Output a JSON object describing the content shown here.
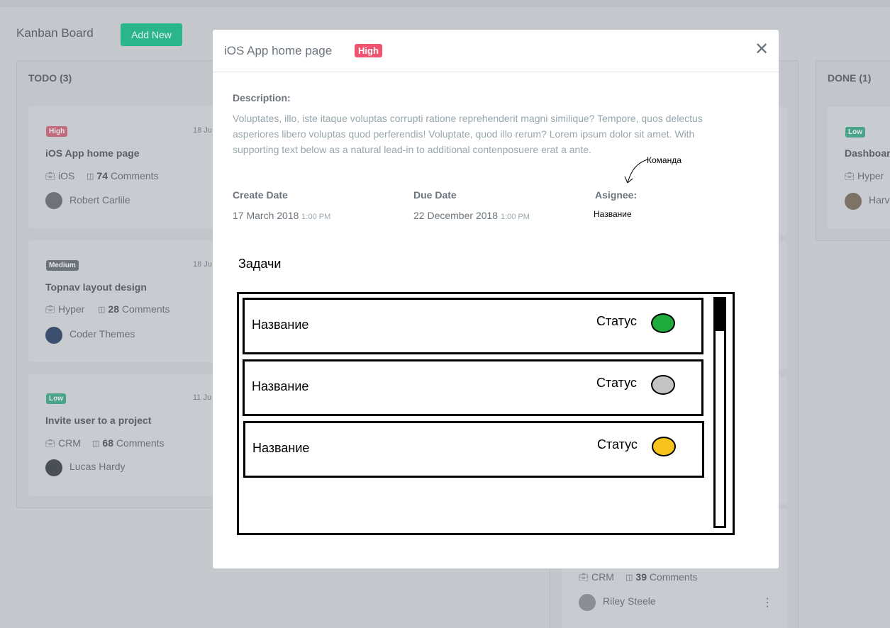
{
  "board": {
    "title": "Kanban Board",
    "add_new_label": "Add New",
    "columns": {
      "todo": {
        "title": "TODO (3)"
      },
      "done": {
        "title": "DONE (1)"
      }
    },
    "todo_cards": [
      {
        "priority": "High",
        "date": "18 Ju",
        "title": "iOS App home page",
        "project": "iOS",
        "comments_count": "74",
        "comments_label": "Comments",
        "user": "Robert Carlile"
      },
      {
        "priority": "Medium",
        "date": "18 Ju",
        "title": "Topnav layout design",
        "project": "Hyper",
        "comments_count": "28",
        "comments_label": "Comments",
        "user": "Coder Themes"
      },
      {
        "priority": "Low",
        "date": "11 Ju",
        "title": "Invite user to a project",
        "project": "CRM",
        "comments_count": "68",
        "comments_label": "Comments",
        "user": "Lucas Hardy"
      }
    ],
    "mid_card": {
      "project": "CRM",
      "comments_count": "39",
      "comments_label": "Comments",
      "user": "Riley Steele"
    },
    "done_card": {
      "priority": "Low",
      "title": "Dashboar",
      "project": "Hyper",
      "user": "Harv"
    }
  },
  "modal": {
    "title": "iOS App home page",
    "priority": "High",
    "close_glyph": "✕",
    "description_label": "Description:",
    "description": "Voluptates, illo, iste itaque voluptas corrupti ratione reprehenderit magni similique? Tempore, quos delectus asperiores libero voluptas quod perferendis! Voluptate, quod illo rerum? Lorem ipsum dolor sit amet. With supporting text below as a natural lead-in to additional contenposuere erat a ante.",
    "create_date_label": "Create Date",
    "create_date": "17 March 2018",
    "create_time": "1:00 PM",
    "due_date_label": "Due Date",
    "due_date": "22 December 2018",
    "due_time": "1:00 PM",
    "assignee_label": "Asignee:",
    "assignee_annotation": "Команда",
    "assignee_value": "Название",
    "tasks_title": "Задачи",
    "tasks": [
      {
        "name": "Название",
        "status_label": "Статус",
        "status_color": "#1faa3c"
      },
      {
        "name": "Название",
        "status_label": "Статус",
        "status_color": "#c3c3c3"
      },
      {
        "name": "Название",
        "status_label": "Статус",
        "status_color": "#f6c21c"
      }
    ]
  },
  "icons": {
    "project": "briefcase-icon",
    "comments": "comments-icon",
    "close": "close-icon",
    "more": "kebab-menu-icon"
  }
}
